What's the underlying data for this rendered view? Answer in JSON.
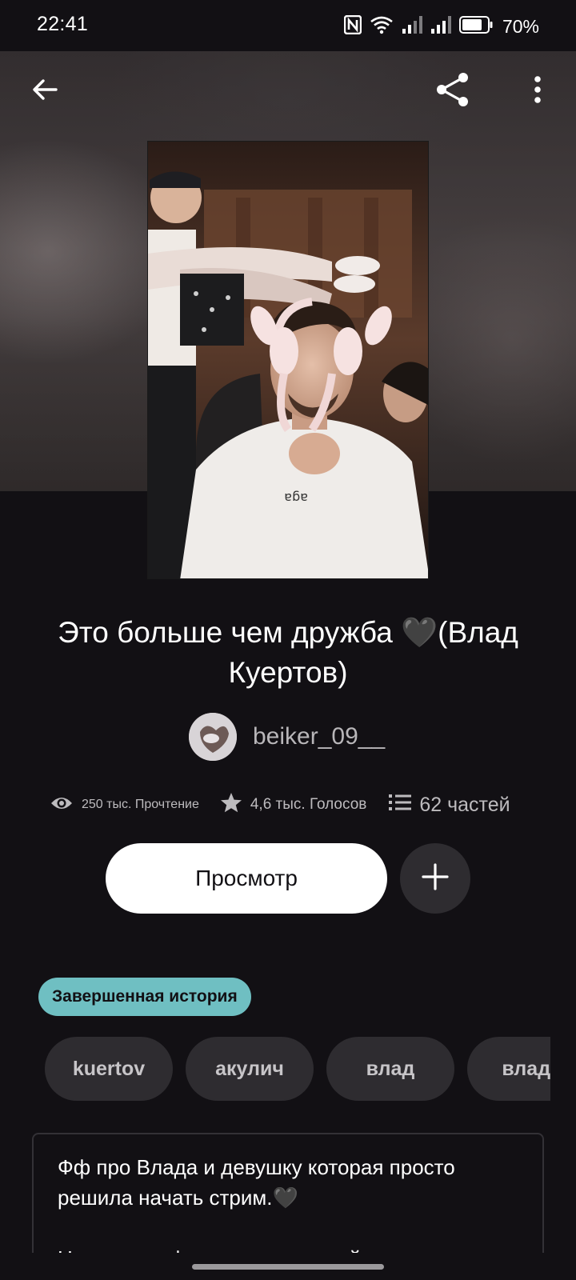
{
  "status_bar": {
    "time": "22:41",
    "battery": "70%",
    "icons": [
      "nfc-icon",
      "wifi-icon",
      "signal-icon",
      "signal-icon",
      "battery-icon"
    ]
  },
  "header": {
    "back_icon": "arrow-left-icon",
    "share_icon": "share-icon",
    "more_icon": "more-vertical-icon"
  },
  "story": {
    "title": "Это больше чем дружба 🖤(Влад Куертов)",
    "author": "beiker_09__",
    "stats": {
      "reads": "250 тыс. Прочтение",
      "votes": "4,6 тыс. Голосов",
      "parts": "62 частей"
    },
    "read_button": "Просмотр",
    "add_icon": "plus-icon",
    "status_badge": "Завершенная история",
    "tags": [
      "kuertov",
      "акулич",
      "влад",
      "владк"
    ],
    "description": [
      "Фф про Влада и девушку которая просто",
      "решила начать стрим.🖤",
      "",
      "Некоторые фрагменты из моей жизни"
    ]
  },
  "colors": {
    "background": "#121014",
    "badge": "#6fbfc2",
    "chip": "#2e2c30",
    "button": "#ffffff"
  }
}
